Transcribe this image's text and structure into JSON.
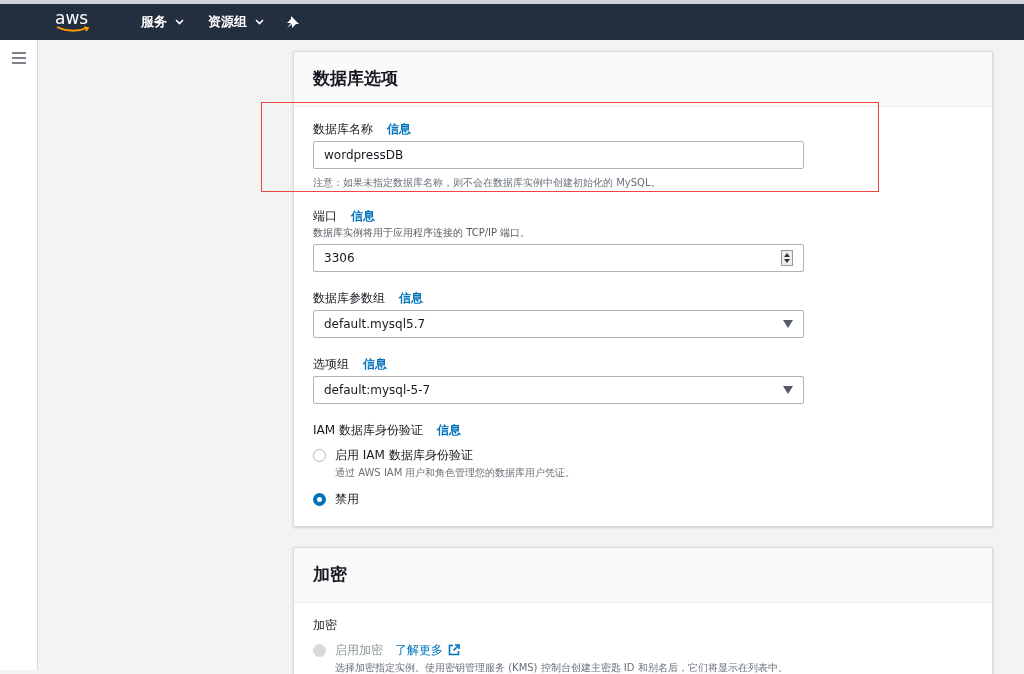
{
  "top_nav": {
    "logo": "aws",
    "menus": [
      {
        "label": "服务"
      },
      {
        "label": "资源组"
      }
    ]
  },
  "sections": [
    {
      "title": "数据库选项",
      "fields": [
        {
          "kind": "text",
          "label": "数据库名称",
          "info": "信息",
          "value": "wordpressDB",
          "help_below": "注意：如果未指定数据库名称，则不会在数据库实例中创建初始化的 MySQL。",
          "highlighted": true
        },
        {
          "kind": "number",
          "label": "端口",
          "info": "信息",
          "help_above": "数据库实例将用于应用程序连接的 TCP/IP 端口。",
          "value": "3306",
          "highlighted": false
        },
        {
          "kind": "select",
          "label": "数据库参数组",
          "info": "信息",
          "value": "default.mysql5.7",
          "highlighted": false
        },
        {
          "kind": "select",
          "label": "选项组",
          "info": "信息",
          "value": "default:mysql-5-7",
          "highlighted": false
        },
        {
          "kind": "radio",
          "label": "IAM 数据库身份验证",
          "info": "信息",
          "highlighted": false,
          "options": [
            {
              "label": "启用 IAM 数据库身份验证",
              "description": "通过 AWS IAM 用户和角色管理您的数据库用户凭证。",
              "selected": false,
              "disabled": false
            },
            {
              "label": "禁用",
              "selected": true,
              "disabled": false
            }
          ]
        }
      ]
    },
    {
      "title": "加密",
      "fields": [
        {
          "kind": "radio",
          "label": "加密",
          "highlighted": false,
          "options": [
            {
              "label": "启用加密",
              "link": "了解更多",
              "description": "选择加密指定实例。使用密钥管理服务 (KMS) 控制台创建主密匙 ID 和别名后，它们将显示在列表中。",
              "selected": false,
              "disabled": true
            }
          ]
        }
      ]
    }
  ]
}
